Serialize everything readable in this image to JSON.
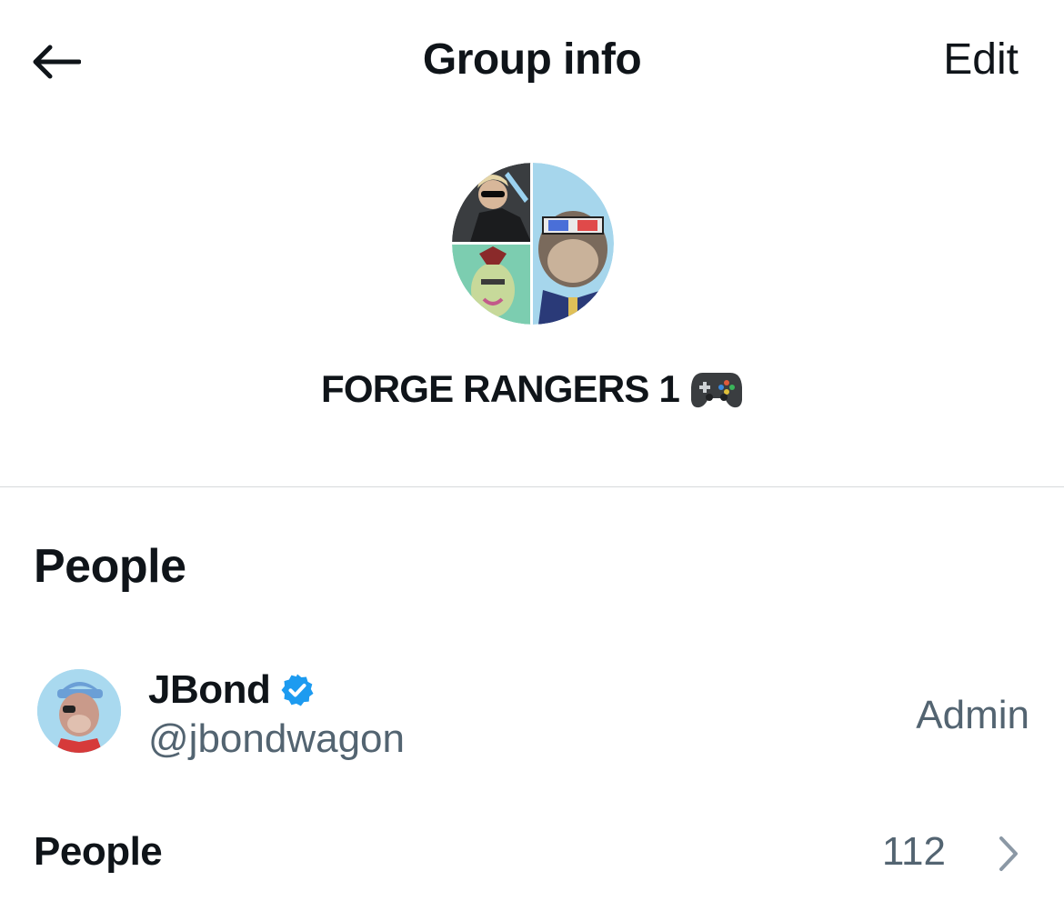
{
  "header": {
    "back_icon": "arrow-left-icon",
    "title": "Group info",
    "edit_label": "Edit"
  },
  "group": {
    "name": "FORGE RANGERS 1",
    "emoji": "🎮",
    "avatar_icon": "group-avatar-collage"
  },
  "people_section": {
    "title": "People",
    "members": [
      {
        "name": "JBond",
        "handle": "@jbondwagon",
        "role": "Admin",
        "verified": true,
        "verified_icon": "verified-badge-icon"
      }
    ],
    "people_row": {
      "label": "People",
      "count": "112",
      "chevron_icon": "chevron-right-icon"
    }
  },
  "colors": {
    "text_primary": "#0f1419",
    "text_secondary": "#536471",
    "verified_blue": "#1d9bf0",
    "divider": "#d6d9db"
  }
}
